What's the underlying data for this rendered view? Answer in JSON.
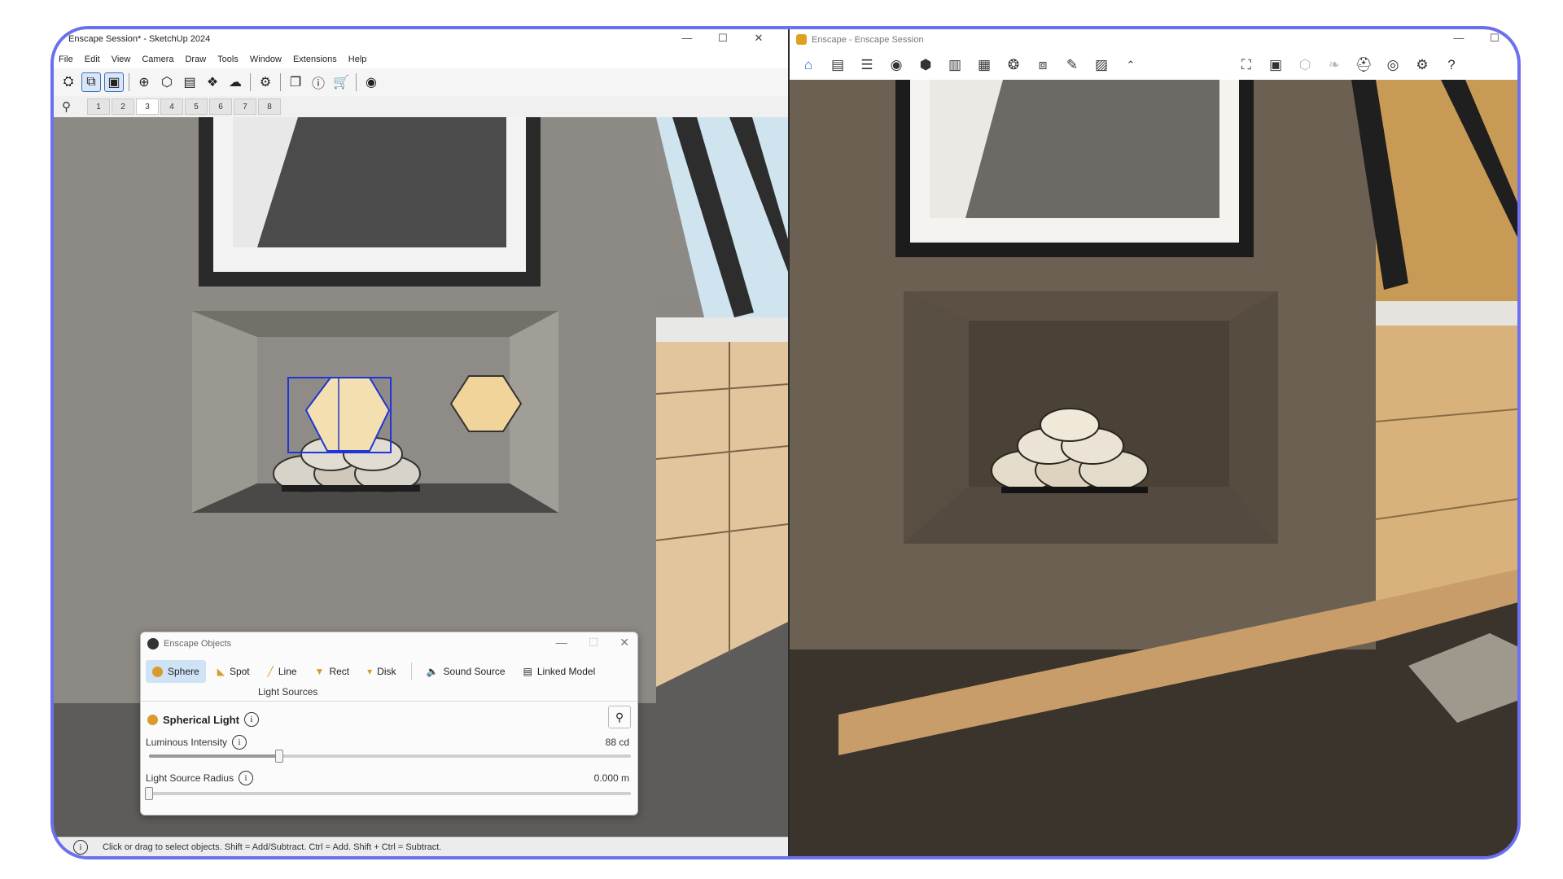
{
  "sketchup": {
    "window_title": "Enscape Session* - SketchUp 2024",
    "window_buttons": [
      "—",
      "☐",
      "✕"
    ],
    "menu": [
      "File",
      "Edit",
      "View",
      "Camera",
      "Draw",
      "Tools",
      "Window",
      "Extensions",
      "Help"
    ],
    "toolbar_icons": [
      "enscape-start-icon",
      "sync-views-icon",
      "capture-icon",
      "add-icon",
      "object-icon",
      "material-icon",
      "asset-library-icon",
      "upload-icon",
      "settings-icon",
      "window-icon",
      "info-icon",
      "cart-icon",
      "account-icon"
    ],
    "scenes": [
      "1",
      "2",
      "3",
      "4",
      "5",
      "6",
      "7",
      "8"
    ],
    "active_scene": "3",
    "status_text": "Click or drag to select objects. Shift = Add/Subtract. Ctrl = Add. Shift + Ctrl = Subtract."
  },
  "enscape_objects": {
    "title": "Enscape Objects",
    "tabs": [
      {
        "label": "Sphere",
        "icon": "sphere-icon",
        "active": true
      },
      {
        "label": "Spot",
        "icon": "spot-icon",
        "active": false
      },
      {
        "label": "Line",
        "icon": "line-icon",
        "active": false
      },
      {
        "label": "Rect",
        "icon": "rect-icon",
        "active": false
      },
      {
        "label": "Disk",
        "icon": "disk-icon",
        "active": false
      },
      {
        "label": "Sound Source",
        "icon": "speaker-icon",
        "active": false
      },
      {
        "label": "Linked Model",
        "icon": "linked-model-icon",
        "active": false
      }
    ],
    "group_label": "Light Sources",
    "section_title": "Spherical Light",
    "luminous_intensity": {
      "label": "Luminous Intensity",
      "value": "88 cd",
      "fraction": 0.27
    },
    "light_source_radius": {
      "label": "Light Source Radius",
      "value": "0.000 m",
      "fraction": 0.0
    }
  },
  "enscape": {
    "window_title": "Enscape - Enscape Session",
    "window_buttons": [
      "—",
      "☐"
    ],
    "toolbar_icons": [
      "home-icon",
      "document-icon",
      "bim-icon",
      "view-icon",
      "object-icon",
      "library-icon",
      "render-icon",
      "settings-icon",
      "screenshot-icon",
      "magic-icon",
      "image-icon",
      "collapse-icon",
      "map-icon",
      "gallery-icon",
      "cube-icon",
      "leaf-icon",
      "vr-icon",
      "visibility-icon",
      "gear-icon",
      "help-icon"
    ]
  },
  "colors": {
    "frame_border": "#6c6ff0",
    "active_tab": "#cfe3f6",
    "light_orange": "#d89b2c"
  }
}
